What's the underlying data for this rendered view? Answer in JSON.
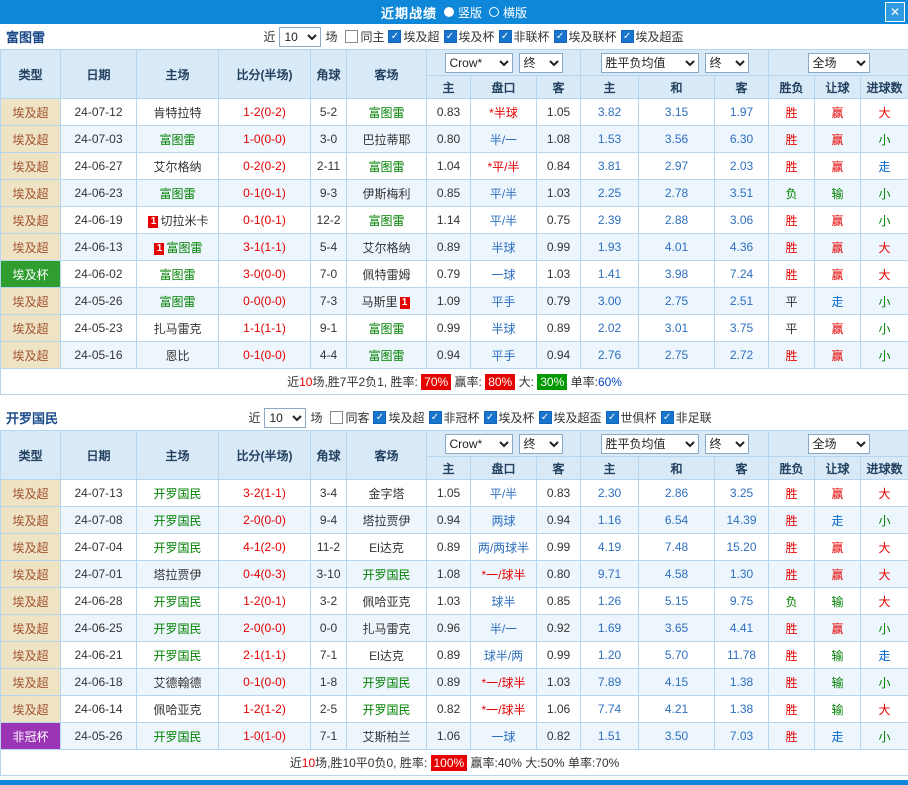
{
  "titlebar": {
    "title": "近期战绩",
    "radio_vertical": "竖版",
    "radio_horizontal": "横版",
    "close_icon": "✕"
  },
  "colors": {
    "titlebar_blue": "#0e87d8",
    "win_red": "#e60000",
    "lose_green": "#008000",
    "walk_blue": "#0066cc",
    "euro_odds_blue": "#2d6fc0",
    "team_self_green": "#008000",
    "score_red": "#e60000",
    "type_league_bg": "#efe3c6",
    "type_league_text": "#a0522d",
    "type_cup_bg": "#2f9e2f",
    "type_afc_bg": "#9b35b5",
    "rate_red_bg": "#e60000",
    "rate_green_bg": "#009900",
    "header_bg": "#d8eaf8"
  },
  "columns": [
    "类型",
    "日期",
    "主场",
    "比分(半场)",
    "角球",
    "客场",
    "主",
    "盘口",
    "客",
    "主",
    "和",
    "客",
    "胜负",
    "让球",
    "进球数"
  ],
  "sections": [
    {
      "team": "富图雷",
      "filter": {
        "near_label": "近",
        "count": "10",
        "matches_label": "场",
        "checkboxes": [
          {
            "label": "同主",
            "checked": false
          },
          {
            "label": "埃及超",
            "checked": true
          },
          {
            "label": "埃及杯",
            "checked": true
          },
          {
            "label": "非联杯",
            "checked": true
          },
          {
            "label": "埃及联杯",
            "checked": true
          },
          {
            "label": "埃及超盃",
            "checked": true
          }
        ]
      },
      "selects": {
        "bookmaker": "Crow*",
        "bookmaker_time": "终",
        "europe": "胜平负均值",
        "europe_time": "终",
        "scope": "全场"
      },
      "rows": [
        {
          "type": "埃及超",
          "date": "24-07-12",
          "home": {
            "text": "肯特拉特"
          },
          "score": "1-2(0-2)",
          "corner": "5-2",
          "away": {
            "text": "富图雷",
            "self": true
          },
          "ah_home": "0.83",
          "ah_line": "*半球",
          "ah_away": "1.05",
          "eu_home": "3.82",
          "eu_draw": "3.15",
          "eu_away": "1.97",
          "result": "胜",
          "ah_result": "赢",
          "goal": "大"
        },
        {
          "type": "埃及超",
          "date": "24-07-03",
          "home": {
            "text": "富图雷",
            "self": true
          },
          "score": "1-0(0-0)",
          "corner": "3-0",
          "away": {
            "text": "巴拉蒂耶"
          },
          "ah_home": "0.80",
          "ah_line": "半/一",
          "ah_away": "1.08",
          "eu_home": "1.53",
          "eu_draw": "3.56",
          "eu_away": "6.30",
          "result": "胜",
          "ah_result": "赢",
          "goal": "小"
        },
        {
          "type": "埃及超",
          "date": "24-06-27",
          "home": {
            "text": "艾尔格纳"
          },
          "score": "0-2(0-2)",
          "corner": "2-11",
          "away": {
            "text": "富图雷",
            "self": true
          },
          "ah_home": "1.04",
          "ah_line": "*平/半",
          "ah_away": "0.84",
          "eu_home": "3.81",
          "eu_draw": "2.97",
          "eu_away": "2.03",
          "result": "胜",
          "ah_result": "赢",
          "goal": "走"
        },
        {
          "type": "埃及超",
          "date": "24-06-23",
          "home": {
            "text": "富图雷",
            "self": true
          },
          "score": "0-1(0-1)",
          "corner": "9-3",
          "away": {
            "text": "伊斯梅利"
          },
          "ah_home": "0.85",
          "ah_line": "平/半",
          "ah_away": "1.03",
          "eu_home": "2.25",
          "eu_draw": "2.78",
          "eu_away": "3.51",
          "result": "负",
          "ah_result": "输",
          "goal": "小"
        },
        {
          "type": "埃及超",
          "date": "24-06-19",
          "home": {
            "text": "切拉米卡",
            "badge": "1",
            "badge_pos": "before"
          },
          "score": "0-1(0-1)",
          "corner": "12-2",
          "away": {
            "text": "富图雷",
            "self": true
          },
          "ah_home": "1.14",
          "ah_line": "平/半",
          "ah_away": "0.75",
          "eu_home": "2.39",
          "eu_draw": "2.88",
          "eu_away": "3.06",
          "result": "胜",
          "ah_result": "赢",
          "goal": "小"
        },
        {
          "type": "埃及超",
          "date": "24-06-13",
          "home": {
            "text": "富图雷",
            "self": true,
            "badge": "1",
            "badge_pos": "before"
          },
          "score": "3-1(1-1)",
          "corner": "5-4",
          "away": {
            "text": "艾尔格纳"
          },
          "ah_home": "0.89",
          "ah_line": "半球",
          "ah_away": "0.99",
          "eu_home": "1.93",
          "eu_draw": "4.01",
          "eu_away": "4.36",
          "result": "胜",
          "ah_result": "赢",
          "goal": "大"
        },
        {
          "type": "埃及杯",
          "date": "24-06-02",
          "home": {
            "text": "富图雷",
            "self": true
          },
          "score": "3-0(0-0)",
          "corner": "7-0",
          "away": {
            "text": "佩特雷姆"
          },
          "ah_home": "0.79",
          "ah_line": "一球",
          "ah_away": "1.03",
          "eu_home": "1.41",
          "eu_draw": "3.98",
          "eu_away": "7.24",
          "result": "胜",
          "ah_result": "赢",
          "goal": "大"
        },
        {
          "type": "埃及超",
          "date": "24-05-26",
          "home": {
            "text": "富图雷",
            "self": true
          },
          "score": "0-0(0-0)",
          "corner": "7-3",
          "away": {
            "text": "马斯里",
            "badge": "1",
            "badge_pos": "after"
          },
          "ah_home": "1.09",
          "ah_line": "平手",
          "ah_away": "0.79",
          "eu_home": "3.00",
          "eu_draw": "2.75",
          "eu_away": "2.51",
          "result": "平",
          "ah_result": "走",
          "goal": "小"
        },
        {
          "type": "埃及超",
          "date": "24-05-23",
          "home": {
            "text": "扎马雷克"
          },
          "score": "1-1(1-1)",
          "corner": "9-1",
          "away": {
            "text": "富图雷",
            "self": true
          },
          "ah_home": "0.99",
          "ah_line": "半球",
          "ah_away": "0.89",
          "eu_home": "2.02",
          "eu_draw": "3.01",
          "eu_away": "3.75",
          "result": "平",
          "ah_result": "赢",
          "goal": "小"
        },
        {
          "type": "埃及超",
          "date": "24-05-16",
          "home": {
            "text": "恩比"
          },
          "score": "0-1(0-0)",
          "corner": "4-4",
          "away": {
            "text": "富图雷",
            "self": true
          },
          "ah_home": "0.94",
          "ah_line": "平手",
          "ah_away": "0.94",
          "eu_home": "2.76",
          "eu_draw": "2.75",
          "eu_away": "2.72",
          "result": "胜",
          "ah_result": "赢",
          "goal": "小"
        }
      ],
      "summary_parts": [
        {
          "text": "近"
        },
        {
          "text": "10",
          "cls": "red-text"
        },
        {
          "text": "场,胜7平2负1, 胜率: "
        },
        {
          "text": "70%",
          "cls": "badge-red"
        },
        {
          "text": " 赢率: "
        },
        {
          "text": "80%",
          "cls": "badge-red"
        },
        {
          "text": " 大: "
        },
        {
          "text": "30%",
          "cls": "badge-green"
        },
        {
          "text": " 单率:"
        },
        {
          "text": "60%",
          "cls": "blue-text"
        }
      ]
    },
    {
      "team": "开罗国民",
      "filter": {
        "near_label": "近",
        "count": "10",
        "matches_label": "场",
        "checkboxes": [
          {
            "label": "同客",
            "checked": false
          },
          {
            "label": "埃及超",
            "checked": true
          },
          {
            "label": "非冠杯",
            "checked": true
          },
          {
            "label": "埃及杯",
            "checked": true
          },
          {
            "label": "埃及超盃",
            "checked": true
          },
          {
            "label": "世俱杯",
            "checked": true
          },
          {
            "label": "非足联",
            "checked": true
          }
        ]
      },
      "selects": {
        "bookmaker": "Crow*",
        "bookmaker_time": "终",
        "europe": "胜平负均值",
        "europe_time": "终",
        "scope": "全场"
      },
      "rows": [
        {
          "type": "埃及超",
          "date": "24-07-13",
          "home": {
            "text": "开罗国民",
            "self": true
          },
          "score": "3-2(1-1)",
          "corner": "3-4",
          "away": {
            "text": "金字塔"
          },
          "ah_home": "1.05",
          "ah_line": "平/半",
          "ah_away": "0.83",
          "eu_home": "2.30",
          "eu_draw": "2.86",
          "eu_away": "3.25",
          "result": "胜",
          "ah_result": "赢",
          "goal": "大"
        },
        {
          "type": "埃及超",
          "date": "24-07-08",
          "home": {
            "text": "开罗国民",
            "self": true
          },
          "score": "2-0(0-0)",
          "corner": "9-4",
          "away": {
            "text": "塔拉贾伊"
          },
          "ah_home": "0.94",
          "ah_line": "两球",
          "ah_away": "0.94",
          "eu_home": "1.16",
          "eu_draw": "6.54",
          "eu_away": "14.39",
          "result": "胜",
          "ah_result": "走",
          "goal": "小"
        },
        {
          "type": "埃及超",
          "date": "24-07-04",
          "home": {
            "text": "开罗国民",
            "self": true
          },
          "score": "4-1(2-0)",
          "corner": "11-2",
          "away": {
            "text": "El达克"
          },
          "ah_home": "0.89",
          "ah_line": "两/两球半",
          "ah_away": "0.99",
          "eu_home": "4.19",
          "eu_draw": "7.48",
          "eu_away": "15.20",
          "result": "胜",
          "ah_result": "赢",
          "goal": "大"
        },
        {
          "type": "埃及超",
          "date": "24-07-01",
          "home": {
            "text": "塔拉贾伊"
          },
          "score": "0-4(0-3)",
          "corner": "3-10",
          "away": {
            "text": "开罗国民",
            "self": true
          },
          "ah_home": "1.08",
          "ah_line": "*一/球半",
          "ah_away": "0.80",
          "eu_home": "9.71",
          "eu_draw": "4.58",
          "eu_away": "1.30",
          "result": "胜",
          "ah_result": "赢",
          "goal": "大"
        },
        {
          "type": "埃及超",
          "date": "24-06-28",
          "home": {
            "text": "开罗国民",
            "self": true
          },
          "score": "1-2(0-1)",
          "corner": "3-2",
          "away": {
            "text": "佩哈亚克"
          },
          "ah_home": "1.03",
          "ah_line": "球半",
          "ah_away": "0.85",
          "eu_home": "1.26",
          "eu_draw": "5.15",
          "eu_away": "9.75",
          "result": "负",
          "ah_result": "输",
          "goal": "大"
        },
        {
          "type": "埃及超",
          "date": "24-06-25",
          "home": {
            "text": "开罗国民",
            "self": true
          },
          "score": "2-0(0-0)",
          "corner": "0-0",
          "away": {
            "text": "扎马雷克"
          },
          "ah_home": "0.96",
          "ah_line": "半/一",
          "ah_away": "0.92",
          "eu_home": "1.69",
          "eu_draw": "3.65",
          "eu_away": "4.41",
          "result": "胜",
          "ah_result": "赢",
          "goal": "小"
        },
        {
          "type": "埃及超",
          "date": "24-06-21",
          "home": {
            "text": "开罗国民",
            "self": true
          },
          "score": "2-1(1-1)",
          "corner": "7-1",
          "away": {
            "text": "El达克"
          },
          "ah_home": "0.89",
          "ah_line": "球半/两",
          "ah_away": "0.99",
          "eu_home": "1.20",
          "eu_draw": "5.70",
          "eu_away": "11.78",
          "result": "胜",
          "ah_result": "输",
          "goal": "走"
        },
        {
          "type": "埃及超",
          "date": "24-06-18",
          "home": {
            "text": "艾德翰德"
          },
          "score": "0-1(0-0)",
          "corner": "1-8",
          "away": {
            "text": "开罗国民",
            "self": true
          },
          "ah_home": "0.89",
          "ah_line": "*一/球半",
          "ah_away": "1.03",
          "eu_home": "7.89",
          "eu_draw": "4.15",
          "eu_away": "1.38",
          "result": "胜",
          "ah_result": "输",
          "goal": "小"
        },
        {
          "type": "埃及超",
          "date": "24-06-14",
          "home": {
            "text": "佩哈亚克"
          },
          "score": "1-2(1-2)",
          "corner": "2-5",
          "away": {
            "text": "开罗国民",
            "self": true
          },
          "ah_home": "0.82",
          "ah_line": "*一/球半",
          "ah_away": "1.06",
          "eu_home": "7.74",
          "eu_draw": "4.21",
          "eu_away": "1.38",
          "result": "胜",
          "ah_result": "输",
          "goal": "大"
        },
        {
          "type": "非冠杯",
          "date": "24-05-26",
          "home": {
            "text": "开罗国民",
            "self": true
          },
          "score": "1-0(1-0)",
          "corner": "7-1",
          "away": {
            "text": "艾斯柏兰"
          },
          "ah_home": "1.06",
          "ah_line": "一球",
          "ah_away": "0.82",
          "eu_home": "1.51",
          "eu_draw": "3.50",
          "eu_away": "7.03",
          "result": "胜",
          "ah_result": "走",
          "goal": "小"
        }
      ],
      "summary_parts": [
        {
          "text": "近"
        },
        {
          "text": "10",
          "cls": "red-text"
        },
        {
          "text": "场,胜10平0负0, 胜率: "
        },
        {
          "text": "100%",
          "cls": "badge-red"
        },
        {
          "text": " 赢率:"
        },
        {
          "text": "40%"
        },
        {
          "text": " 大:"
        },
        {
          "text": "50%"
        },
        {
          "text": " 单率:"
        },
        {
          "text": "70%"
        }
      ]
    }
  ]
}
